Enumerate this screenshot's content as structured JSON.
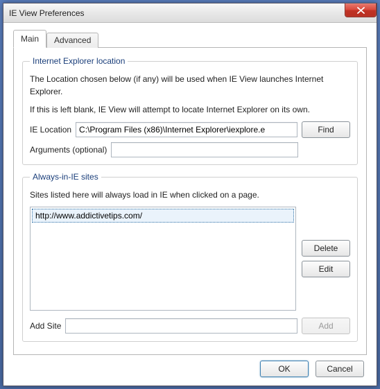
{
  "window": {
    "title": "IE View Preferences"
  },
  "tabs": {
    "main": "Main",
    "advanced": "Advanced"
  },
  "ie_location": {
    "legend": "Internet Explorer location",
    "help1": "The Location chosen below (if any) will be used when IE View launches Internet Explorer.",
    "help2": "If this is left blank, IE View will attempt to locate Internet Explorer on its own.",
    "path_label": "IE Location",
    "path_value": "C:\\Program Files (x86)\\Internet Explorer\\iexplore.e",
    "find_label": "Find",
    "args_label": "Arguments (optional)",
    "args_value": ""
  },
  "always": {
    "legend": "Always-in-IE sites",
    "help": "Sites listed here will always load in IE when clicked on a page.",
    "items": [
      "http://www.addictivetips.com/"
    ],
    "delete_label": "Delete",
    "edit_label": "Edit",
    "add_site_label": "Add Site",
    "add_value": "",
    "add_label": "Add"
  },
  "footer": {
    "ok": "OK",
    "cancel": "Cancel"
  }
}
